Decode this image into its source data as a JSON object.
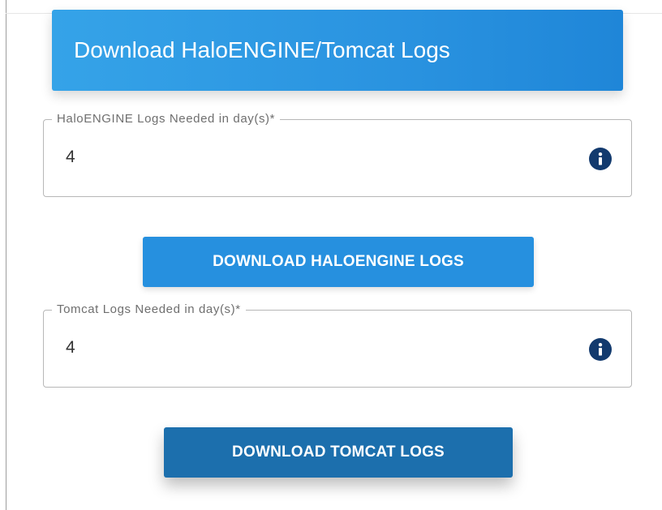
{
  "header": {
    "title": "Download HaloENGINE/Tomcat Logs"
  },
  "haloengine_field": {
    "label": "HaloENGINE Logs Needed in day(s)*",
    "value": "4",
    "icon": "info-icon"
  },
  "haloengine_button": {
    "label": "DOWNLOAD HALOENGINE LOGS"
  },
  "tomcat_field": {
    "label": "Tomcat Logs Needed in day(s)*",
    "value": "4",
    "icon": "info-icon"
  },
  "tomcat_button": {
    "label": "DOWNLOAD TOMCAT LOGS"
  },
  "colors": {
    "header_blue": "#2a93e0",
    "button_blue": "#2690df",
    "button_dark_blue": "#1c6fad",
    "info_icon": "#123a6e"
  }
}
